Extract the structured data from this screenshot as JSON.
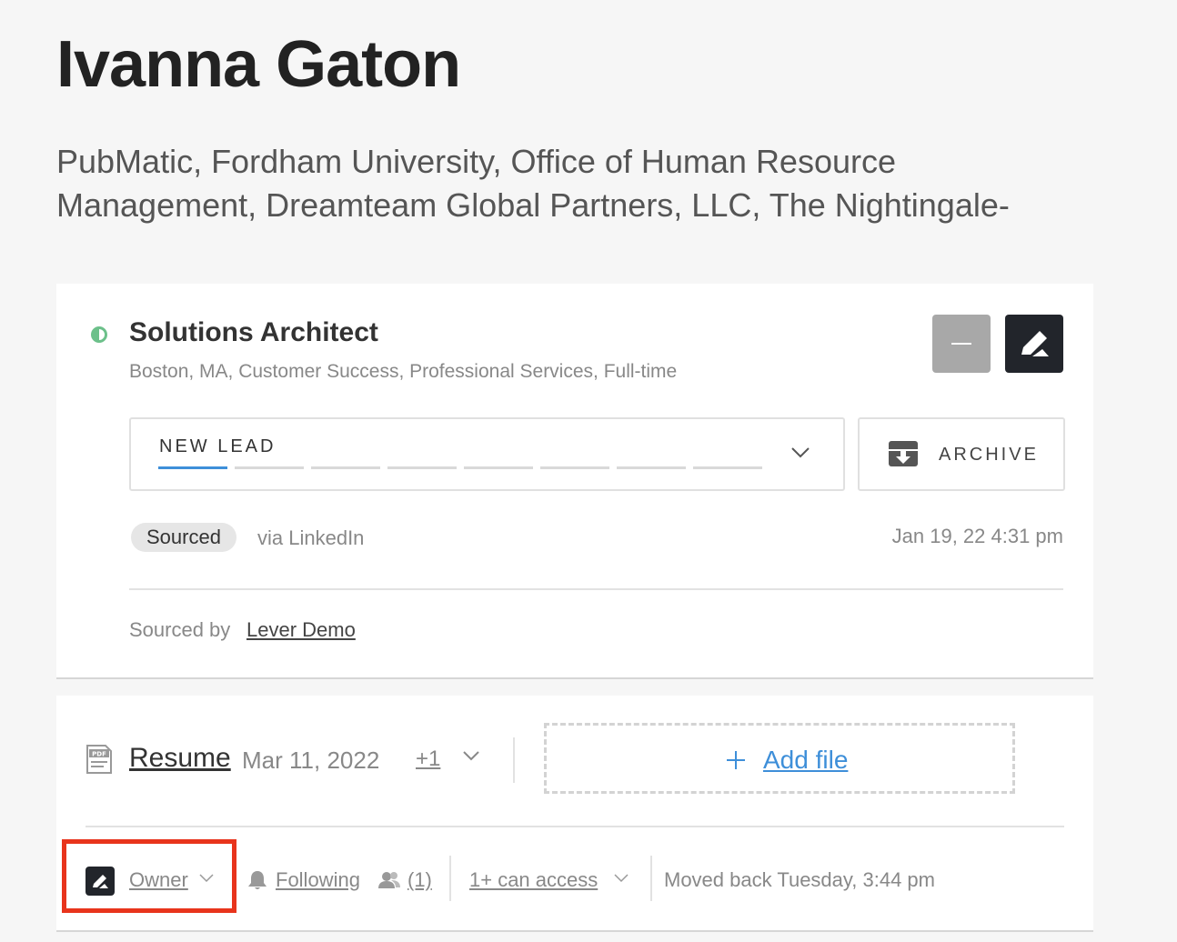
{
  "candidate": {
    "name": "Ivanna Gaton",
    "organizations": "PubMatic, Fordham University, Office of Human Resource Management, Dreamteam Global Partners, LLC, The Nightingale-"
  },
  "opportunity": {
    "title": "Solutions Architect",
    "meta": "Boston, MA, Customer Success, Professional Services, Full-time",
    "stage_label": "NEW LEAD",
    "archive_label": "ARCHIVE",
    "source_badge": "Sourced",
    "source_via": "via LinkedIn",
    "source_date": "Jan 19, 22 4:31 pm",
    "sourced_by_label": "Sourced by",
    "sourced_by_name": "Lever Demo"
  },
  "files": {
    "resume_label": "Resume",
    "resume_date": "Mar 11, 2022",
    "more_count": "+1",
    "add_file_label": "Add file"
  },
  "footer": {
    "owner_label": "Owner",
    "following_label": "Following",
    "followers_count": "(1)",
    "access_label": "1+ can access",
    "moved_text": "Moved back Tuesday, 3:44 pm"
  },
  "colors": {
    "accent_blue": "#3e8fd9",
    "highlight_red": "#e8341c",
    "status_green": "#6cc08a",
    "dark_button": "#22252b"
  }
}
